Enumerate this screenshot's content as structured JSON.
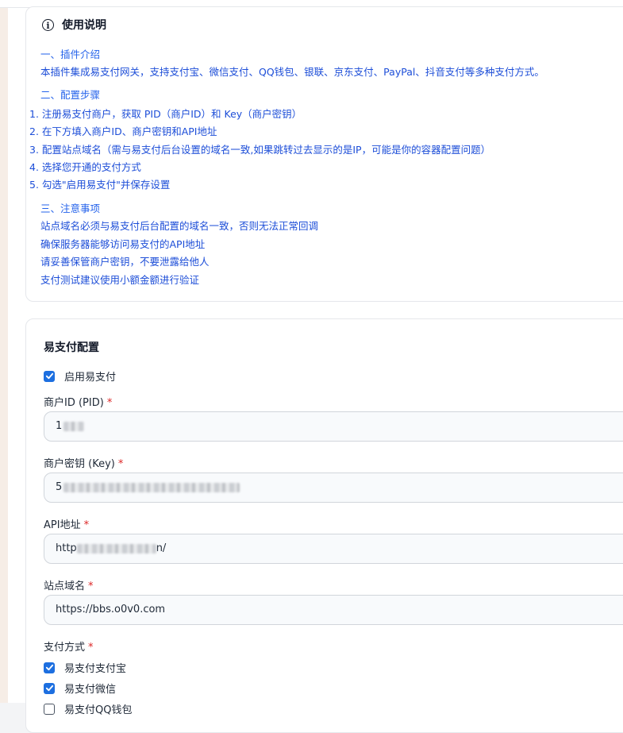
{
  "instructions": {
    "title": "使用说明",
    "section1": {
      "heading": "一、插件介绍",
      "lines": [
        "本插件集成易支付网关，支持支付宝、微信支付、QQ钱包、银联、京东支付、PayPal、抖音支付等多种支付方式。"
      ]
    },
    "section2": {
      "heading": "二、配置步骤",
      "lines": [
        "1. 注册易支付商户，获取 PID（商户ID）和 Key（商户密钥）",
        "2. 在下方填入商户ID、商户密钥和API地址",
        "3. 配置站点域名（需与易支付后台设置的域名一致,如果跳转过去显示的是IP，可能是你的容器配置问题）",
        "4. 选择您开通的支付方式",
        "5. 勾选\"启用易支付\"并保存设置"
      ]
    },
    "section3": {
      "heading": "三、注意事项",
      "lines": [
        "站点域名必须与易支付后台配置的域名一致，否则无法正常回调",
        "确保服务器能够访问易支付的API地址",
        "请妥善保管商户密钥，不要泄露给他人",
        "支付测试建议使用小额金额进行验证"
      ]
    }
  },
  "config": {
    "title": "易支付配置",
    "enable_label": "启用易支付",
    "enable_checked": true,
    "fields": {
      "pid": {
        "label": "商户ID (PID)",
        "value_prefix": "1"
      },
      "key": {
        "label": "商户密钥 (Key)",
        "value_prefix": "5"
      },
      "api": {
        "label": "API地址",
        "value_prefix": "http",
        "value_suffix": "n/"
      },
      "domain": {
        "label": "站点域名",
        "value": "https://bbs.o0v0.com"
      }
    },
    "required_mark": "*",
    "pay_methods_label": "支付方式",
    "pay_methods": [
      {
        "label": "易支付支付宝",
        "checked": true
      },
      {
        "label": "易支付微信",
        "checked": true
      },
      {
        "label": "易支付QQ钱包",
        "checked": false
      }
    ]
  },
  "colors": {
    "accent": "#1d6fe0",
    "link_text": "#1d4ed8",
    "required": "#dc2626"
  }
}
